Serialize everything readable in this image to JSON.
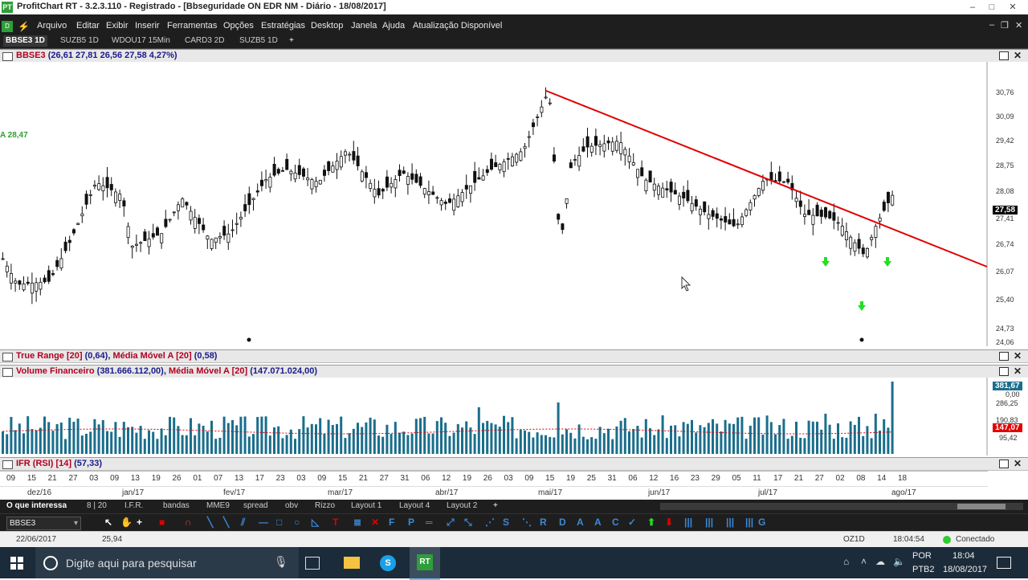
{
  "window": {
    "title": "ProfitChart RT - 3.2.3.110 - Registrado - [Bbseguridade ON EDR NM - Diário - 18/08/2017]",
    "logo": "PT"
  },
  "menu": [
    "Arquivo",
    "Editar",
    "Exibir",
    "Inserir",
    "Ferramentas",
    "Opções",
    "Estratégias",
    "Desktop",
    "Janela",
    "Ajuda",
    "Atualização Disponível"
  ],
  "tabs": [
    "BBSE3 1D",
    "SUZB5 1D",
    "WDOU17 15Min",
    "CARD3 2D",
    "SUZB5 1D",
    "+"
  ],
  "price_panel": {
    "symbol": "BBSE3",
    "values": "(26,61  27,81  26,56  27,58  4,27%)",
    "left_label": "A 28,47",
    "axis_ticks": [
      "30,76",
      "30,09",
      "29,42",
      "28,75",
      "28,08",
      "27,41",
      "26,74",
      "26,07",
      "25,40",
      "24,73",
      "24,06"
    ],
    "current": "27,58"
  },
  "true_range": {
    "name": "True Range [20]",
    "val": "(0,64),",
    "ma": "Média Móvel A [20]",
    "ma_val": "(0,58)"
  },
  "volume": {
    "name": "Volume Financeiro",
    "val": "(381.666.112,00),",
    "ma": "Média Móvel A [20]",
    "ma_val": "(147.071.024,00)",
    "axis_ticks": [
      "0,00",
      "286,25",
      "190,83",
      "95,42"
    ],
    "last_badge": "381,67",
    "ma_badge": "147,07"
  },
  "rsi": {
    "name": "IFR (RSI) [14]",
    "val": "(57,33)"
  },
  "date_axis": {
    "days": [
      "09",
      "15",
      "21",
      "27",
      "03",
      "09",
      "13",
      "19",
      "26",
      "01",
      "07",
      "13",
      "17",
      "23",
      "03",
      "09",
      "15",
      "21",
      "27",
      "31",
      "06",
      "12",
      "19",
      "26",
      "03",
      "09",
      "15",
      "19",
      "25",
      "31",
      "06",
      "12",
      "16",
      "23",
      "29",
      "05",
      "11",
      "17",
      "21",
      "27",
      "02",
      "08",
      "14",
      "18"
    ],
    "months": [
      "dez/16",
      "jan/17",
      "fev/17",
      "mar/17",
      "abr/17",
      "mai/17",
      "jun/17",
      "jul/17",
      "ago/17"
    ]
  },
  "bottom_tabs": [
    "O que interessa",
    "8 | 20",
    "I.F.R.",
    "bandas",
    "MME9",
    "spread",
    "obv",
    "Rizzo",
    "Layout 1",
    "Layout 4",
    "Layout 2",
    "+"
  ],
  "toolbar": {
    "symbol": "BBSE3"
  },
  "status": {
    "date": "22/06/2017",
    "value": "25,94",
    "code": "OZ1D",
    "time": "18:04:54",
    "conn": "Conectado"
  },
  "taskbar": {
    "search": "Digite aqui para pesquisar",
    "lang": "POR",
    "kbd": "PTB2",
    "clock": "18:04",
    "date": "18/08/2017"
  },
  "colors": {
    "bg": "#1e1e1e",
    "trend": "#e00000",
    "volume": "#1a6e8c",
    "arrow": "#22e022"
  },
  "chart_data": {
    "type": "candlestick",
    "trendline": {
      "from": [
        "mai/17",
        30.9
      ],
      "to": [
        "ago/17",
        26.3
      ]
    },
    "last_close": 27.58
  }
}
